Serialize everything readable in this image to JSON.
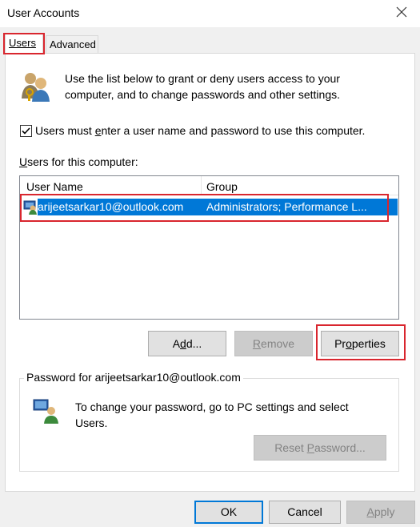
{
  "window": {
    "title": "User Accounts"
  },
  "tabs": [
    {
      "label": "Users"
    },
    {
      "label": "Advanced"
    }
  ],
  "intro_text": "Use the list below to grant or deny users access to your computer, and to change passwords and other settings.",
  "require_login": {
    "label_pre": "Users must ",
    "label_mn": "e",
    "label_post": "nter a user name and password to use this computer.",
    "checked": true
  },
  "users_label": {
    "mn": "U",
    "rest": "sers for this computer:"
  },
  "table": {
    "headers": [
      "User Name",
      "Group"
    ],
    "rows": [
      {
        "name": "arijeetsarkar10@outlook.com",
        "group": "Administrators; Performance L..."
      }
    ]
  },
  "buttons": {
    "add": {
      "pre": "A",
      "mn": "d",
      "post": "d..."
    },
    "remove": {
      "mn": "R",
      "post": "emove"
    },
    "properties": {
      "pre": "Pr",
      "mn": "o",
      "post": "perties"
    },
    "reset": {
      "pre": "Reset ",
      "mn": "P",
      "post": "assword..."
    },
    "ok": "OK",
    "cancel": "Cancel",
    "apply": {
      "mn": "A",
      "post": "pply"
    }
  },
  "password_group": {
    "title": "Password for arijeetsarkar10@outlook.com",
    "text": "To change your password, go to PC settings and select Users."
  },
  "colors": {
    "selection": "#0078d7",
    "highlight": "#d9262e"
  }
}
